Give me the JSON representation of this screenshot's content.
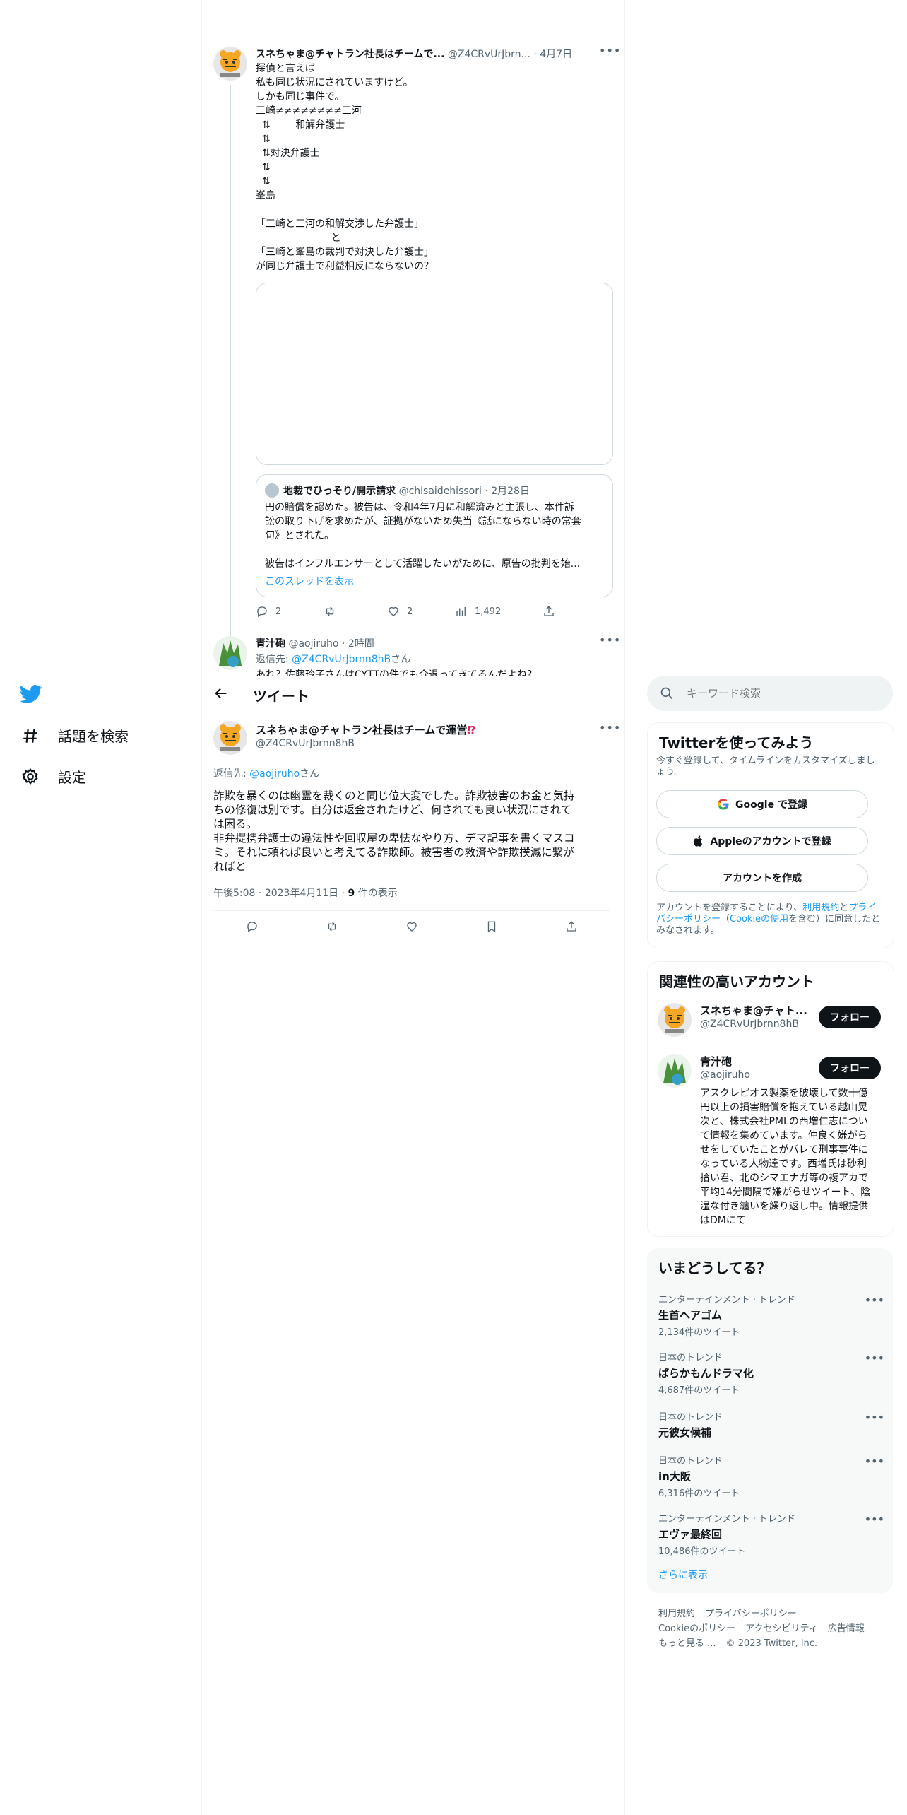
{
  "nav": {
    "explore_label": "話題を検索",
    "settings_label": "設定"
  },
  "header": {
    "title": "ツイート"
  },
  "thread_tweet": {
    "name": "スネちゃま@チャトラン社長はチームで...",
    "handle": "@Z4CRvUrJbrn...",
    "date": "4月7日",
    "lines": [
      "探偵と言えば",
      "私も同じ状況にされていますけど。",
      "しかも同じ事件で。",
      "三崎≠≠≠≠≠≠≠≠三河",
      "  ⇅        和解弁護士",
      "  ⇅",
      "  ⇅対決弁護士",
      "  ⇅",
      "  ⇅",
      "峯島",
      "",
      "「三崎と三河の和解交渉した弁護士」",
      "                        と",
      "「三崎と峯島の裁判で対決した弁護士」",
      "が同じ弁護士で利益相反にならないの？"
    ],
    "quote": {
      "name": "地裁でひっそり/開示請求",
      "handle": "@chisaidehissori",
      "date": "2月28日",
      "lines": [
        "円の賠償を認めた。被告は、令和4年7月に和解済みと主張し、本件訴",
        "訟の取り下げを求めたが、証拠がないため失当《話にならない時の常套",
        "句》とされた。",
        "",
        "被告はインフルエンサーとして活躍したいがために、原告の批判を始..."
      ],
      "show_thread": "このスレッドを表示"
    },
    "stats": {
      "replies": "2",
      "likes": "2",
      "views": "1,492"
    }
  },
  "reply_tweet": {
    "name": "青汁砲",
    "handle": "@aojiruho",
    "time": "2時間",
    "reply_prefix": "返信先:",
    "reply_to": "@Z4CRvUrJbrnn8hB",
    "reply_suffix": "さん",
    "text": "あれ？佐藤玲子さんはCYTTの件でも介退ってきてるんだよね？"
  },
  "main_tweet": {
    "name": "スネちゃま@チャトラン社長はチームで運営",
    "badge": "⁉",
    "handle": "@Z4CRvUrJbrnn8hB",
    "reply_prefix": "返信先:",
    "reply_to": "@aojiruho",
    "reply_suffix": "さん",
    "lines": [
      "詐欺を暴くのは幽霊を裁くのと同じ位大変でした。詐欺被害のお金と気持",
      "ちの修復は別です。自分は返金されたけど、何されても良い状況にされて",
      "は困る。",
      "非弁提携弁護士の違法性や回収屋の卑怯なやり方、デマ記事を書くマスコ",
      "ミ。それに頼れば良いと考えてる詐欺師。被害者の救済や詐欺撲滅に繋が",
      "ればと"
    ],
    "time": "午後5:08",
    "date": "2023年4月11日",
    "views": "9",
    "views_label": "件の表示"
  },
  "search": {
    "placeholder": "キーワード検索"
  },
  "signup": {
    "title": "Twitterを使ってみよう",
    "subtitle_lines": [
      "今すぐ登録して、タイムラインをカスタマイズしまし",
      "ょう。"
    ],
    "google": "Google で登録",
    "apple": "Appleのアカウントで登録",
    "create": "アカウントを作成",
    "legal_lines": [
      [
        "アカウントを登録することにより、",
        "利用規約",
        "と",
        "プライ"
      ],
      [
        "バシーポリシー",
        "（",
        "Cookieの使用",
        "を含む）に同意したと"
      ],
      [
        "みなされます。"
      ]
    ]
  },
  "relevant": {
    "title": "関連性の高いアカウント",
    "accounts": [
      {
        "name": "スネちゃま@チャト...",
        "handle": "@Z4CRvUrJbrnn8hB",
        "follow": "フォロー"
      },
      {
        "name": "青汁砲",
        "handle": "@aojiruho",
        "follow": "フォロー",
        "bio_lines": [
          "アスクレピオス製薬を破壊して数十億",
          "円以上の損害賠償を抱えている越山晃",
          "次と、株式会社PMLの西増仁志につい",
          "て情報を集めています。仲良く嫌がら",
          "せをしていたことがバレて刑事事件に",
          "なっている人物達です。西増氏は砂利",
          "拾い君、北のシマエナガ等の複アカで",
          "平均14分間隔で嫌がらせツイート、陰",
          "湿な付き纏いを繰り返し中。情報提供",
          "はDMにて"
        ]
      }
    ]
  },
  "trends": {
    "title": "いまどうしてる？",
    "items": [
      {
        "category": "エンターテインメント · トレンド",
        "name": "生首ヘアゴム",
        "count": "2,134件のツイート"
      },
      {
        "category": "日本のトレンド",
        "name": "ばらかもんドラマ化",
        "count": "4,687件のツイート"
      },
      {
        "category": "日本のトレンド",
        "name": "元彼女候補",
        "count": ""
      },
      {
        "category": "日本のトレンド",
        "name": "in大阪",
        "count": "6,316件のツイート"
      },
      {
        "category": "エンターテインメント · トレンド",
        "name": "エヴァ最終回",
        "count": "10,486件のツイート"
      }
    ],
    "show_more": "さらに表示"
  },
  "footer": {
    "row1": [
      "利用規約",
      "プライバシーポリシー"
    ],
    "row2": [
      "Cookieのポリシー",
      "アクセシビリティ",
      "広告情報"
    ],
    "row3": [
      "もっと見る ...",
      "© 2023 Twitter, Inc."
    ]
  },
  "colors": {
    "accent": "#1d9bf0",
    "text": "#0f1419",
    "muted": "#536471",
    "border": "#eff3f4"
  }
}
